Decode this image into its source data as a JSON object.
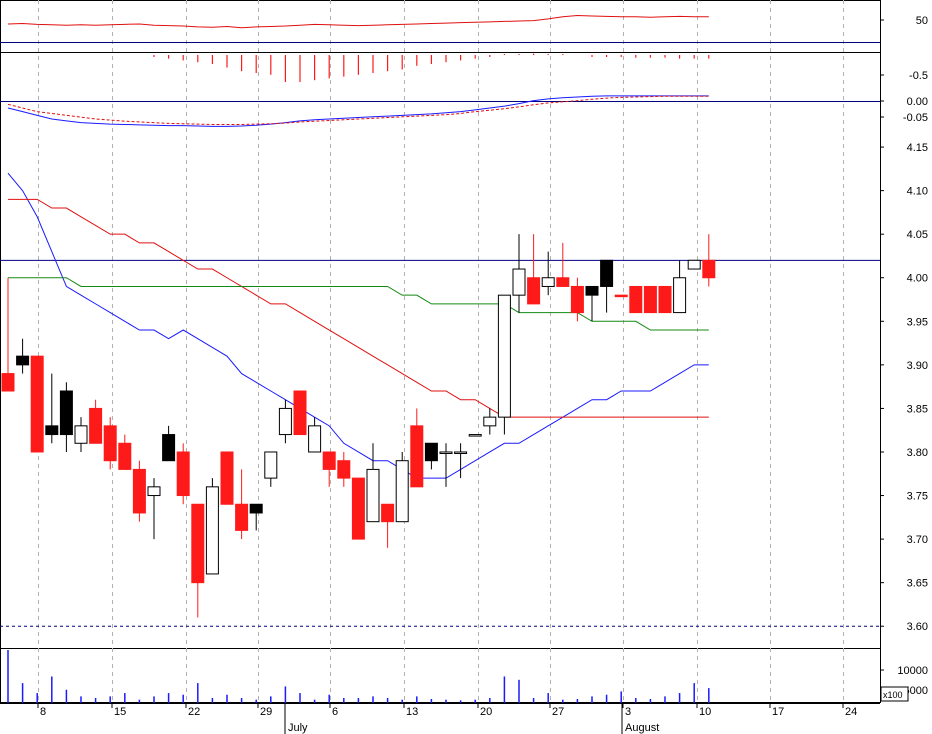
{
  "colors": {
    "up": "#ffffff",
    "down_red": "#ff1a1a",
    "down_black": "#000000",
    "ma_fast": "#1a1aff",
    "ma_mid": "#e01010",
    "ma_slow": "#138a13",
    "grid": "#b0b0b0",
    "axis": "#000080",
    "panel_sep": "#000000"
  },
  "chart_data": [
    {
      "type": "candlestick",
      "panel": "price",
      "yaxis_ticks": [
        "4.15",
        "4.10",
        "4.05",
        "4.00",
        "3.95",
        "3.90",
        "3.85",
        "3.80",
        "3.75",
        "3.70",
        "3.65",
        "3.60"
      ],
      "ylim": [
        3.575,
        4.165
      ],
      "hlines": [
        4.02,
        3.6
      ],
      "x_ticks": [
        "8",
        "15",
        "22",
        "29",
        "6",
        "13",
        "20",
        "27",
        "3",
        "10",
        "17",
        "24"
      ],
      "x_month_labels": [
        "July",
        "August"
      ],
      "candles": [
        {
          "o": 3.87,
          "h": 4.0,
          "l": 3.87,
          "c": 3.89,
          "color": "red"
        },
        {
          "o": 3.91,
          "h": 3.93,
          "l": 3.89,
          "c": 3.9,
          "color": "black"
        },
        {
          "o": 3.91,
          "h": 3.91,
          "l": 3.8,
          "c": 3.8,
          "color": "red"
        },
        {
          "o": 3.82,
          "h": 3.89,
          "l": 3.81,
          "c": 3.83,
          "color": "black"
        },
        {
          "o": 3.82,
          "h": 3.88,
          "l": 3.8,
          "c": 3.87,
          "color": "black"
        },
        {
          "o": 3.81,
          "h": 3.84,
          "l": 3.8,
          "c": 3.83,
          "color": "up"
        },
        {
          "o": 3.85,
          "h": 3.86,
          "l": 3.81,
          "c": 3.81,
          "color": "red"
        },
        {
          "o": 3.83,
          "h": 3.84,
          "l": 3.78,
          "c": 3.79,
          "color": "red"
        },
        {
          "o": 3.81,
          "h": 3.82,
          "l": 3.78,
          "c": 3.78,
          "color": "red"
        },
        {
          "o": 3.78,
          "h": 3.79,
          "l": 3.72,
          "c": 3.73,
          "color": "red"
        },
        {
          "o": 3.75,
          "h": 3.77,
          "l": 3.7,
          "c": 3.76,
          "color": "up"
        },
        {
          "o": 3.79,
          "h": 3.83,
          "l": 3.79,
          "c": 3.82,
          "color": "black"
        },
        {
          "o": 3.8,
          "h": 3.81,
          "l": 3.74,
          "c": 3.75,
          "color": "red"
        },
        {
          "o": 3.74,
          "h": 3.74,
          "l": 3.61,
          "c": 3.65,
          "color": "red"
        },
        {
          "o": 3.66,
          "h": 3.77,
          "l": 3.66,
          "c": 3.76,
          "color": "up"
        },
        {
          "o": 3.8,
          "h": 3.8,
          "l": 3.74,
          "c": 3.74,
          "color": "red"
        },
        {
          "o": 3.74,
          "h": 3.78,
          "l": 3.7,
          "c": 3.71,
          "color": "red"
        },
        {
          "o": 3.73,
          "h": 3.74,
          "l": 3.71,
          "c": 3.74,
          "color": "black"
        },
        {
          "o": 3.77,
          "h": 3.8,
          "l": 3.76,
          "c": 3.8,
          "color": "up"
        },
        {
          "o": 3.82,
          "h": 3.86,
          "l": 3.81,
          "c": 3.85,
          "color": "up"
        },
        {
          "o": 3.87,
          "h": 3.87,
          "l": 3.82,
          "c": 3.82,
          "color": "red"
        },
        {
          "o": 3.8,
          "h": 3.84,
          "l": 3.8,
          "c": 3.83,
          "color": "up"
        },
        {
          "o": 3.8,
          "h": 3.8,
          "l": 3.76,
          "c": 3.78,
          "color": "red"
        },
        {
          "o": 3.79,
          "h": 3.8,
          "l": 3.76,
          "c": 3.77,
          "color": "red"
        },
        {
          "o": 3.77,
          "h": 3.77,
          "l": 3.7,
          "c": 3.7,
          "color": "red"
        },
        {
          "o": 3.72,
          "h": 3.81,
          "l": 3.72,
          "c": 3.78,
          "color": "up"
        },
        {
          "o": 3.74,
          "h": 3.74,
          "l": 3.69,
          "c": 3.72,
          "color": "red"
        },
        {
          "o": 3.72,
          "h": 3.8,
          "l": 3.72,
          "c": 3.79,
          "color": "up"
        },
        {
          "o": 3.83,
          "h": 3.85,
          "l": 3.76,
          "c": 3.76,
          "color": "red"
        },
        {
          "o": 3.79,
          "h": 3.81,
          "l": 3.78,
          "c": 3.81,
          "color": "black"
        },
        {
          "o": 3.8,
          "h": 3.81,
          "l": 3.76,
          "c": 3.8,
          "color": "up"
        },
        {
          "o": 3.8,
          "h": 3.81,
          "l": 3.77,
          "c": 3.8,
          "color": "up"
        },
        {
          "o": 3.82,
          "h": 3.82,
          "l": 3.82,
          "c": 3.82,
          "color": "up"
        },
        {
          "o": 3.83,
          "h": 3.85,
          "l": 3.82,
          "c": 3.84,
          "color": "up"
        },
        {
          "o": 3.84,
          "h": 3.98,
          "l": 3.82,
          "c": 3.98,
          "color": "up"
        },
        {
          "o": 3.98,
          "h": 4.05,
          "l": 3.96,
          "c": 4.01,
          "color": "up"
        },
        {
          "o": 4.0,
          "h": 4.05,
          "l": 3.97,
          "c": 3.97,
          "color": "red"
        },
        {
          "o": 3.99,
          "h": 4.03,
          "l": 3.98,
          "c": 4.0,
          "color": "up"
        },
        {
          "o": 4.0,
          "h": 4.04,
          "l": 3.99,
          "c": 3.99,
          "color": "red"
        },
        {
          "o": 3.99,
          "h": 4.0,
          "l": 3.95,
          "c": 3.96,
          "color": "red"
        },
        {
          "o": 3.98,
          "h": 3.99,
          "l": 3.95,
          "c": 3.99,
          "color": "black"
        },
        {
          "o": 3.99,
          "h": 4.02,
          "l": 3.96,
          "c": 4.02,
          "color": "black"
        },
        {
          "o": 3.98,
          "h": 3.98,
          "l": 3.98,
          "c": 3.98,
          "color": "red"
        },
        {
          "o": 3.99,
          "h": 3.99,
          "l": 3.96,
          "c": 3.96,
          "color": "red"
        },
        {
          "o": 3.99,
          "h": 3.99,
          "l": 3.96,
          "c": 3.96,
          "color": "red"
        },
        {
          "o": 3.99,
          "h": 3.99,
          "l": 3.96,
          "c": 3.96,
          "color": "red"
        },
        {
          "o": 3.96,
          "h": 4.02,
          "l": 3.96,
          "c": 4.0,
          "color": "up"
        },
        {
          "o": 4.01,
          "h": 4.02,
          "l": 4.01,
          "c": 4.02,
          "color": "up"
        },
        {
          "o": 4.02,
          "h": 4.05,
          "l": 3.99,
          "c": 4.0,
          "color": "red"
        }
      ],
      "series": [
        {
          "values": [
            4.12,
            4.1,
            4.07,
            4.03,
            3.99,
            3.98,
            3.97,
            3.96,
            3.95,
            3.94,
            3.94,
            3.93,
            3.94,
            3.93,
            3.92,
            3.91,
            3.89,
            3.88,
            3.87,
            3.86,
            3.85,
            3.84,
            3.83,
            3.81,
            3.8,
            3.79,
            3.79,
            3.78,
            3.77,
            3.77,
            3.77,
            3.78,
            3.79,
            3.8,
            3.81,
            3.81,
            3.82,
            3.83,
            3.84,
            3.85,
            3.86,
            3.86,
            3.87,
            3.87,
            3.87,
            3.88,
            3.89,
            3.9,
            3.9
          ]
        },
        {
          "values": [
            4.09,
            4.09,
            4.09,
            4.08,
            4.08,
            4.07,
            4.06,
            4.05,
            4.05,
            4.04,
            4.04,
            4.03,
            4.02,
            4.01,
            4.01,
            4.0,
            3.99,
            3.98,
            3.97,
            3.97,
            3.96,
            3.95,
            3.94,
            3.93,
            3.92,
            3.91,
            3.9,
            3.89,
            3.88,
            3.87,
            3.87,
            3.86,
            3.86,
            3.85,
            3.84,
            3.84,
            3.84,
            3.84,
            3.84,
            3.84,
            3.84,
            3.84,
            3.84,
            3.84,
            3.84,
            3.84,
            3.84,
            3.84,
            3.84
          ]
        },
        {
          "values": [
            4.0,
            4.0,
            4.0,
            4.0,
            4.0,
            3.99,
            3.99,
            3.99,
            3.99,
            3.99,
            3.99,
            3.99,
            3.99,
            3.99,
            3.99,
            3.99,
            3.99,
            3.99,
            3.99,
            3.99,
            3.99,
            3.99,
            3.99,
            3.99,
            3.99,
            3.99,
            3.99,
            3.98,
            3.98,
            3.97,
            3.97,
            3.97,
            3.97,
            3.97,
            3.97,
            3.96,
            3.96,
            3.96,
            3.96,
            3.96,
            3.95,
            3.95,
            3.95,
            3.95,
            3.94,
            3.94,
            3.94,
            3.94,
            3.94
          ]
        }
      ]
    },
    {
      "type": "line",
      "panel": "oscillator_top",
      "yaxis_ticks": [
        "50"
      ],
      "ylim": [
        0,
        100
      ],
      "series": [
        {
          "values": [
            43,
            44,
            42,
            41,
            40,
            41,
            40,
            41,
            42,
            43,
            40,
            39,
            38,
            36,
            35,
            37,
            34,
            36,
            37,
            38,
            40,
            42,
            41,
            40,
            39,
            40,
            41,
            42,
            43,
            44,
            45,
            46,
            47,
            48,
            49,
            50,
            51,
            55,
            60,
            63,
            62,
            61,
            60,
            60,
            59,
            60,
            61,
            60,
            60
          ]
        }
      ]
    },
    {
      "type": "bar",
      "panel": "histogram",
      "yaxis_ticks": [
        "-0.5"
      ],
      "ylim": [
        -0.6,
        0.1
      ],
      "values": [
        0,
        0,
        0,
        0,
        0,
        0,
        0,
        0,
        0,
        0,
        -0.02,
        -0.04,
        -0.06,
        -0.08,
        -0.1,
        -0.14,
        -0.18,
        -0.2,
        -0.22,
        -0.3,
        -0.3,
        -0.28,
        -0.26,
        -0.24,
        -0.22,
        -0.2,
        -0.18,
        -0.16,
        -0.12,
        -0.1,
        -0.08,
        -0.06,
        -0.04,
        -0.02,
        0.01,
        0.02,
        0.03,
        0.02,
        0.01,
        0,
        -0.01,
        -0.02,
        -0.02,
        -0.03,
        -0.03,
        -0.03,
        -0.04,
        -0.04,
        -0.04
      ]
    },
    {
      "type": "line",
      "panel": "macd",
      "yaxis_ticks": [
        "0.00",
        "-0.05"
      ],
      "ylim": [
        -0.08,
        0.04
      ],
      "series": [
        {
          "values": [
            -0.02,
            -0.03,
            -0.04,
            -0.05,
            -0.055,
            -0.06,
            -0.062,
            -0.064,
            -0.065,
            -0.066,
            -0.067,
            -0.068,
            -0.068,
            -0.069,
            -0.07,
            -0.07,
            -0.069,
            -0.067,
            -0.064,
            -0.06,
            -0.055,
            -0.052,
            -0.05,
            -0.048,
            -0.046,
            -0.044,
            -0.042,
            -0.04,
            -0.038,
            -0.036,
            -0.033,
            -0.03,
            -0.025,
            -0.02,
            -0.015,
            -0.008,
            0.0,
            0.005,
            0.008,
            0.01,
            0.012,
            0.013,
            0.013,
            0.013,
            0.013,
            0.013,
            0.013,
            0.013,
            0.013
          ]
        },
        {
          "values": [
            -0.01,
            -0.02,
            -0.03,
            -0.035,
            -0.04,
            -0.045,
            -0.05,
            -0.053,
            -0.056,
            -0.058,
            -0.06,
            -0.062,
            -0.063,
            -0.064,
            -0.065,
            -0.065,
            -0.065,
            -0.064,
            -0.063,
            -0.061,
            -0.058,
            -0.056,
            -0.054,
            -0.052,
            -0.05,
            -0.048,
            -0.046,
            -0.044,
            -0.042,
            -0.04,
            -0.038,
            -0.035,
            -0.03,
            -0.026,
            -0.022,
            -0.017,
            -0.011,
            -0.006,
            -0.003,
            0.0,
            0.004,
            0.007,
            0.009,
            0.01,
            0.011,
            0.012,
            0.012,
            0.012,
            0.012
          ]
        }
      ]
    },
    {
      "type": "bar",
      "panel": "volume",
      "yaxis_ticks": [
        "10000",
        "5000"
      ],
      "ylim": [
        0,
        16000
      ],
      "scale_label": "x100",
      "values": [
        16000,
        6000,
        3000,
        8000,
        4000,
        2000,
        1500,
        2000,
        3000,
        1000,
        2000,
        3000,
        2500,
        6000,
        1500,
        2500,
        1500,
        1000,
        2000,
        5000,
        3000,
        1000,
        2500,
        1500,
        1500,
        2000,
        1500,
        1000,
        2000,
        1200,
        1000,
        800,
        1000,
        1500,
        8000,
        7000,
        1500,
        3000,
        1000,
        1200,
        2000,
        2500,
        3500,
        1500,
        1200,
        2000,
        3000,
        6000,
        4500
      ]
    }
  ]
}
